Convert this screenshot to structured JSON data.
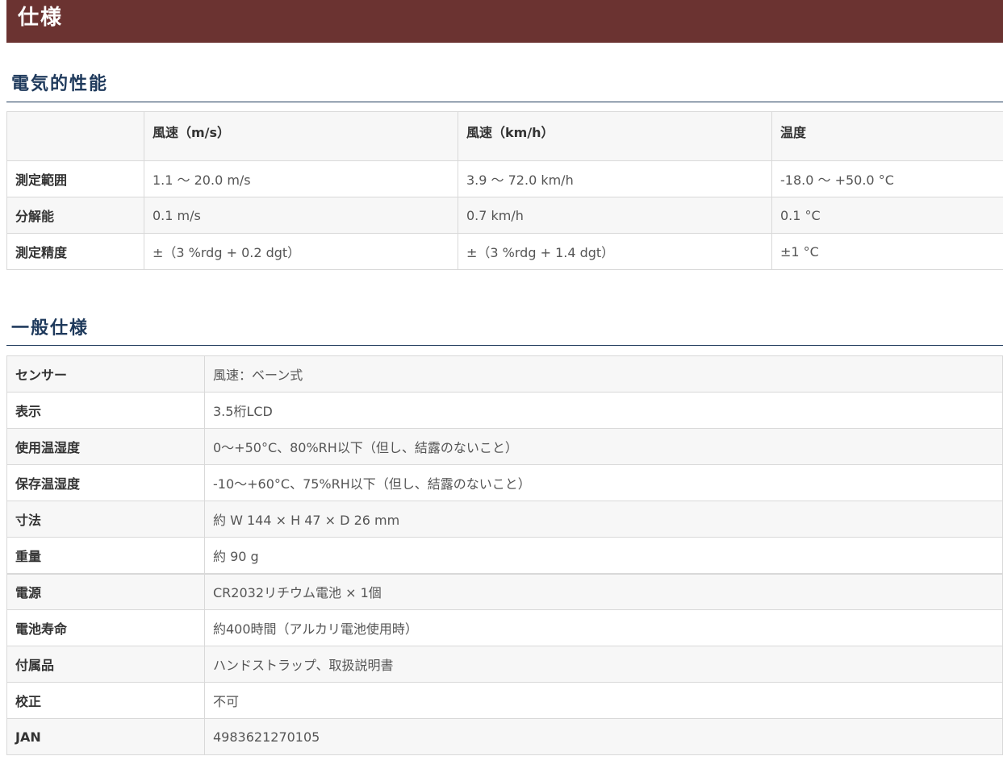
{
  "banner": {
    "title": "仕様"
  },
  "electrical": {
    "title": "電気的性能",
    "headers": [
      "",
      "風速（m/s）",
      "風速（km/h）",
      "温度"
    ],
    "rows": [
      {
        "label": "測定範囲",
        "cells": [
          "1.1 ～ 20.0 m/s",
          "3.9 ～ 72.0 km/h",
          "-18.0 ～ +50.0 °C"
        ]
      },
      {
        "label": "分解能",
        "cells": [
          "0.1 m/s",
          "0.7 km/h",
          "0.1 °C"
        ]
      },
      {
        "label": "測定精度",
        "cells": [
          "±（3 %rdg + 0.2 dgt）",
          "±（3 %rdg + 1.4 dgt）",
          "±1 °C"
        ]
      }
    ]
  },
  "general": {
    "title": "一般仕様",
    "rows": [
      {
        "label": "センサー",
        "value": "風速：ベーン式"
      },
      {
        "label": "表示",
        "value": "3.5桁LCD"
      },
      {
        "label": "使用温湿度",
        "value": "0～+50°C、80%RH以下（但し、結露のないこと）"
      },
      {
        "label": "保存温湿度",
        "value": "-10～+60°C、75%RH以下（但し、結露のないこと）"
      },
      {
        "label": "寸法",
        "value": "約 W 144 × H 47 × D 26 mm"
      },
      {
        "label": "重量",
        "value": "約 90 g"
      },
      {
        "label": "電源",
        "value": "CR2032リチウム電池 × 1個"
      },
      {
        "label": "電池寿命",
        "value": "約400時間（アルカリ電池使用時）"
      },
      {
        "label": "付属品",
        "value": "ハンドストラップ、取扱説明書"
      },
      {
        "label": "校正",
        "value": "不可"
      },
      {
        "label": "JAN",
        "value": "4983621270105"
      }
    ]
  }
}
